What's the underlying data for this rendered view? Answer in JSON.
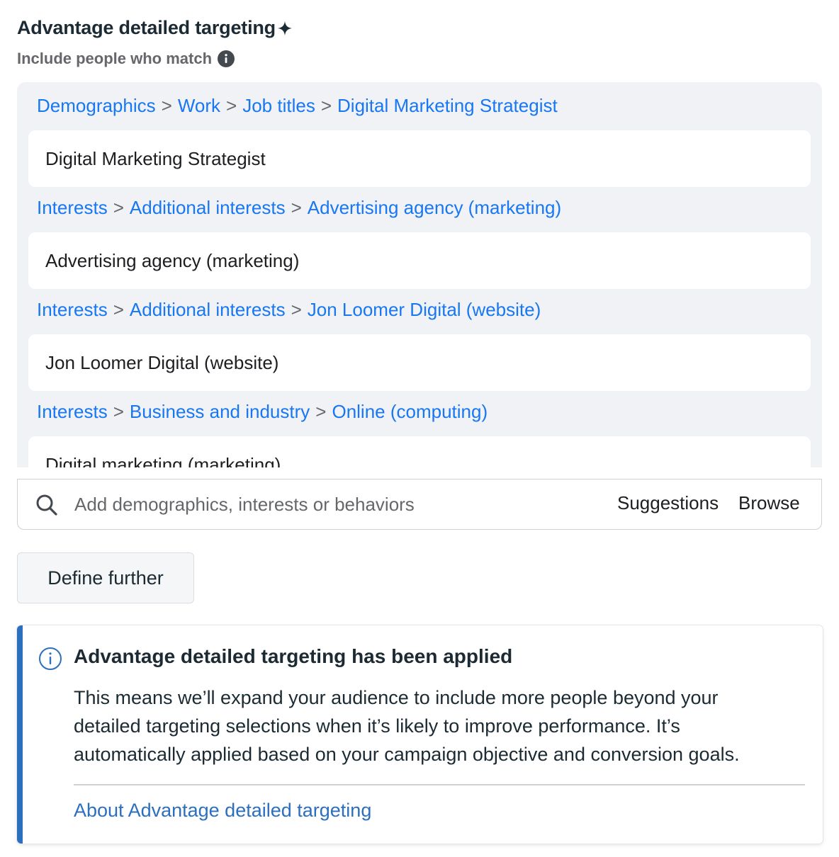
{
  "header": {
    "title": "Advantage detailed targeting",
    "subtitle": "Include people who match",
    "sparkle_icon": "sparkle-icon",
    "info_icon": "info-filled-icon"
  },
  "selections": [
    {
      "path": [
        "Demographics",
        "Work",
        "Job titles",
        "Digital Marketing Strategist"
      ],
      "item": "Digital Marketing Strategist"
    },
    {
      "path": [
        "Interests",
        "Additional interests",
        "Advertising agency (marketing)"
      ],
      "item": "Advertising agency (marketing)"
    },
    {
      "path": [
        "Interests",
        "Additional interests",
        "Jon Loomer Digital (website)"
      ],
      "item": "Jon Loomer Digital (website)"
    },
    {
      "path": [
        "Interests",
        "Business and industry",
        "Online (computing)"
      ],
      "item": "Digital marketing (marketing)"
    }
  ],
  "path_separator": ">",
  "search": {
    "placeholder": "Add demographics, interests or behaviors",
    "suggestions_label": "Suggestions",
    "browse_label": "Browse"
  },
  "define_further_label": "Define further",
  "notice": {
    "title": "Advantage detailed targeting has been applied",
    "body_lines": [
      "This means we’ll expand your audience to include more people beyond your",
      "detailed targeting selections when it’s likely to improve performance. It’s",
      "automatically applied based on your campaign objective and conversion goals."
    ],
    "link_label": "About Advantage detailed targeting"
  },
  "colors": {
    "link_blue": "#1877f2",
    "accent_bar": "#2c6fbf",
    "panel_bg": "#f0f2f5"
  }
}
